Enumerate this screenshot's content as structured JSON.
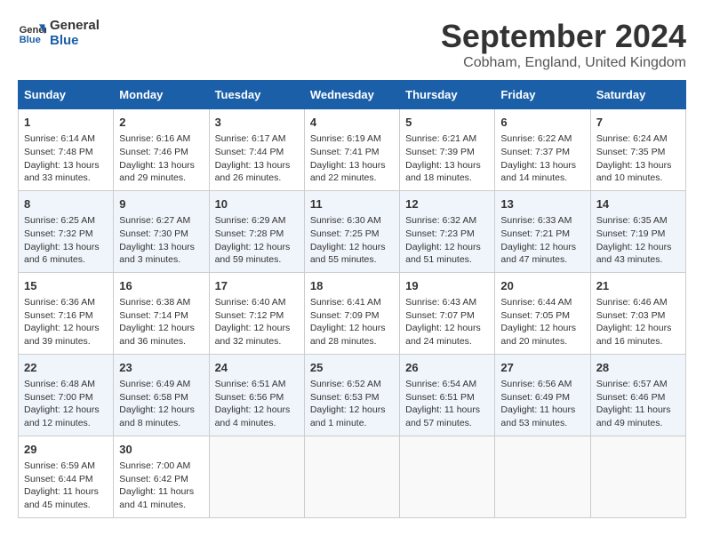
{
  "logo": {
    "line1": "General",
    "line2": "Blue"
  },
  "title": "September 2024",
  "subtitle": "Cobham, England, United Kingdom",
  "days_of_week": [
    "Sunday",
    "Monday",
    "Tuesday",
    "Wednesday",
    "Thursday",
    "Friday",
    "Saturday"
  ],
  "weeks": [
    [
      {
        "day": "1",
        "sunrise": "6:14 AM",
        "sunset": "7:48 PM",
        "daylight": "13 hours and 33 minutes."
      },
      {
        "day": "2",
        "sunrise": "6:16 AM",
        "sunset": "7:46 PM",
        "daylight": "13 hours and 29 minutes."
      },
      {
        "day": "3",
        "sunrise": "6:17 AM",
        "sunset": "7:44 PM",
        "daylight": "13 hours and 26 minutes."
      },
      {
        "day": "4",
        "sunrise": "6:19 AM",
        "sunset": "7:41 PM",
        "daylight": "13 hours and 22 minutes."
      },
      {
        "day": "5",
        "sunrise": "6:21 AM",
        "sunset": "7:39 PM",
        "daylight": "13 hours and 18 minutes."
      },
      {
        "day": "6",
        "sunrise": "6:22 AM",
        "sunset": "7:37 PM",
        "daylight": "13 hours and 14 minutes."
      },
      {
        "day": "7",
        "sunrise": "6:24 AM",
        "sunset": "7:35 PM",
        "daylight": "13 hours and 10 minutes."
      }
    ],
    [
      {
        "day": "8",
        "sunrise": "6:25 AM",
        "sunset": "7:32 PM",
        "daylight": "13 hours and 6 minutes."
      },
      {
        "day": "9",
        "sunrise": "6:27 AM",
        "sunset": "7:30 PM",
        "daylight": "13 hours and 3 minutes."
      },
      {
        "day": "10",
        "sunrise": "6:29 AM",
        "sunset": "7:28 PM",
        "daylight": "12 hours and 59 minutes."
      },
      {
        "day": "11",
        "sunrise": "6:30 AM",
        "sunset": "7:25 PM",
        "daylight": "12 hours and 55 minutes."
      },
      {
        "day": "12",
        "sunrise": "6:32 AM",
        "sunset": "7:23 PM",
        "daylight": "12 hours and 51 minutes."
      },
      {
        "day": "13",
        "sunrise": "6:33 AM",
        "sunset": "7:21 PM",
        "daylight": "12 hours and 47 minutes."
      },
      {
        "day": "14",
        "sunrise": "6:35 AM",
        "sunset": "7:19 PM",
        "daylight": "12 hours and 43 minutes."
      }
    ],
    [
      {
        "day": "15",
        "sunrise": "6:36 AM",
        "sunset": "7:16 PM",
        "daylight": "12 hours and 39 minutes."
      },
      {
        "day": "16",
        "sunrise": "6:38 AM",
        "sunset": "7:14 PM",
        "daylight": "12 hours and 36 minutes."
      },
      {
        "day": "17",
        "sunrise": "6:40 AM",
        "sunset": "7:12 PM",
        "daylight": "12 hours and 32 minutes."
      },
      {
        "day": "18",
        "sunrise": "6:41 AM",
        "sunset": "7:09 PM",
        "daylight": "12 hours and 28 minutes."
      },
      {
        "day": "19",
        "sunrise": "6:43 AM",
        "sunset": "7:07 PM",
        "daylight": "12 hours and 24 minutes."
      },
      {
        "day": "20",
        "sunrise": "6:44 AM",
        "sunset": "7:05 PM",
        "daylight": "12 hours and 20 minutes."
      },
      {
        "day": "21",
        "sunrise": "6:46 AM",
        "sunset": "7:03 PM",
        "daylight": "12 hours and 16 minutes."
      }
    ],
    [
      {
        "day": "22",
        "sunrise": "6:48 AM",
        "sunset": "7:00 PM",
        "daylight": "12 hours and 12 minutes."
      },
      {
        "day": "23",
        "sunrise": "6:49 AM",
        "sunset": "6:58 PM",
        "daylight": "12 hours and 8 minutes."
      },
      {
        "day": "24",
        "sunrise": "6:51 AM",
        "sunset": "6:56 PM",
        "daylight": "12 hours and 4 minutes."
      },
      {
        "day": "25",
        "sunrise": "6:52 AM",
        "sunset": "6:53 PM",
        "daylight": "12 hours and 1 minute."
      },
      {
        "day": "26",
        "sunrise": "6:54 AM",
        "sunset": "6:51 PM",
        "daylight": "11 hours and 57 minutes."
      },
      {
        "day": "27",
        "sunrise": "6:56 AM",
        "sunset": "6:49 PM",
        "daylight": "11 hours and 53 minutes."
      },
      {
        "day": "28",
        "sunrise": "6:57 AM",
        "sunset": "6:46 PM",
        "daylight": "11 hours and 49 minutes."
      }
    ],
    [
      {
        "day": "29",
        "sunrise": "6:59 AM",
        "sunset": "6:44 PM",
        "daylight": "11 hours and 45 minutes."
      },
      {
        "day": "30",
        "sunrise": "7:00 AM",
        "sunset": "6:42 PM",
        "daylight": "11 hours and 41 minutes."
      },
      null,
      null,
      null,
      null,
      null
    ]
  ]
}
